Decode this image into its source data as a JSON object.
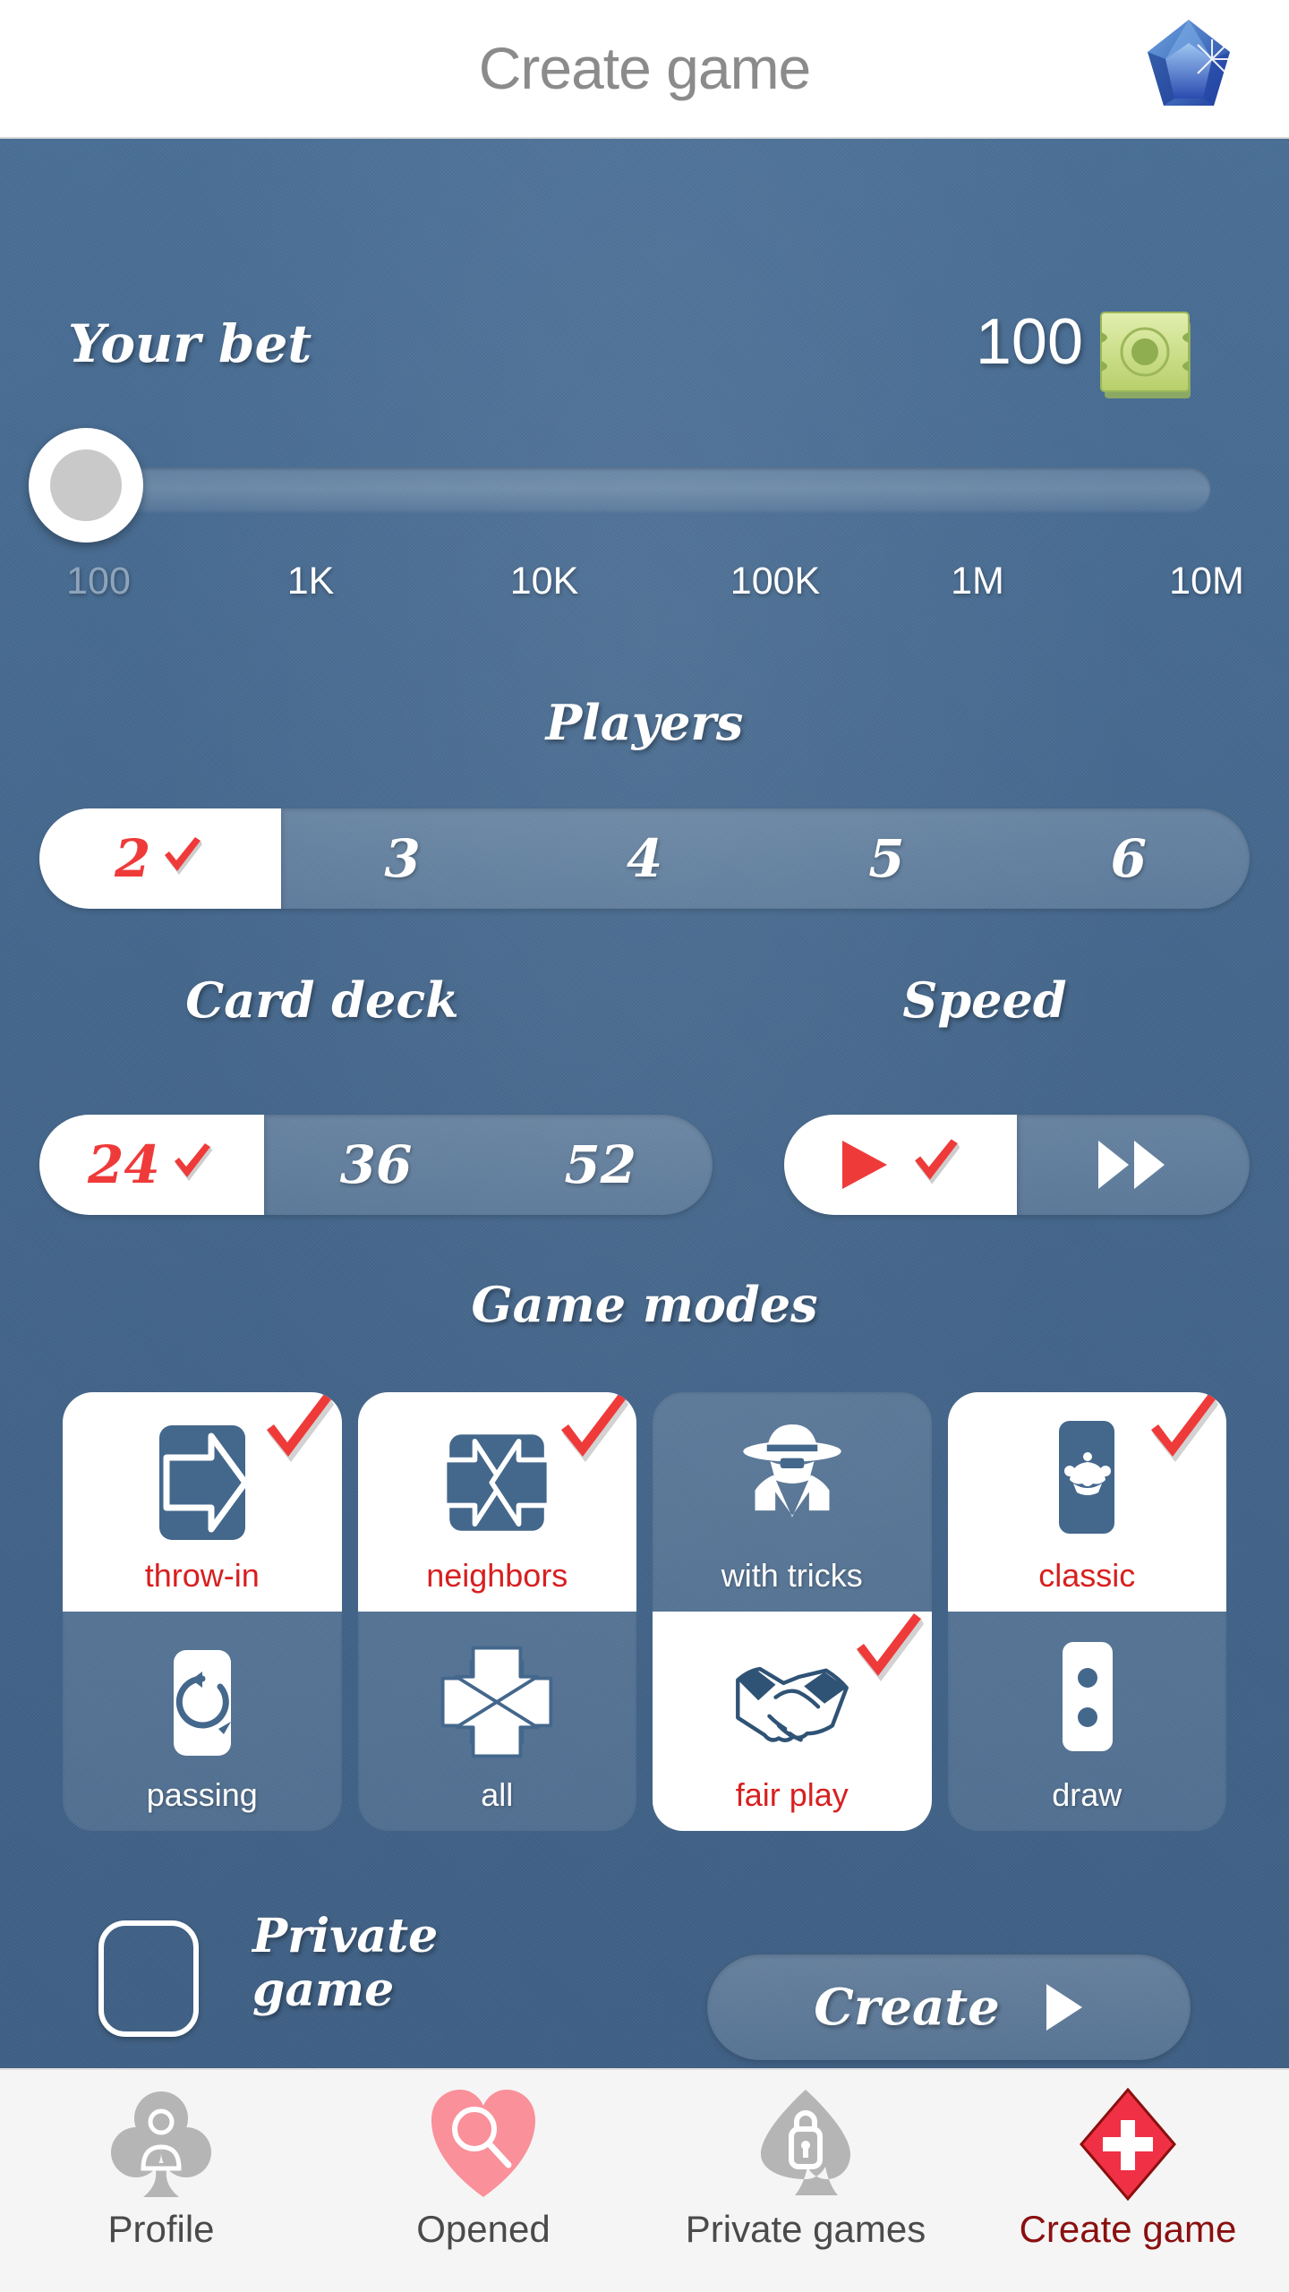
{
  "header": {
    "title": "Create game",
    "logo_icon": "blue-gem-icon"
  },
  "bet": {
    "label": "Your bet",
    "value": "100",
    "money_icon": "cash-banknote-icon",
    "slider": {
      "position_percent": 0,
      "current_tick": "100",
      "ticks": [
        "100",
        "1K",
        "10K",
        "100K",
        "1M",
        "10M"
      ]
    }
  },
  "players": {
    "title": "Players",
    "options": [
      "2",
      "3",
      "4",
      "5",
      "6"
    ],
    "selected": "2"
  },
  "card_deck": {
    "title": "Card deck",
    "options": [
      "24",
      "36",
      "52"
    ],
    "selected": "24"
  },
  "speed": {
    "title": "Speed",
    "options": [
      "normal-speed-icon",
      "fast-forward-icon"
    ],
    "selected": "normal-speed-icon"
  },
  "game_modes": {
    "title": "Game modes",
    "columns": [
      {
        "top": {
          "label": "throw-in",
          "icon": "arrow-right-throw-in-icon",
          "selected": true
        },
        "bottom": {
          "label": "passing",
          "icon": "circular-arrow-passing-icon",
          "selected": false
        }
      },
      {
        "top": {
          "label": "neighbors",
          "icon": "two-arrows-inward-icon",
          "selected": true
        },
        "bottom": {
          "label": "all",
          "icon": "four-arrows-inward-icon",
          "selected": false
        }
      },
      {
        "top": {
          "label": "with tricks",
          "icon": "cowboy-cheater-icon",
          "selected": false
        },
        "bottom": {
          "label": "fair play",
          "icon": "handshake-icon",
          "selected": true
        }
      },
      {
        "top": {
          "label": "classic",
          "icon": "joker-card-icon",
          "selected": true
        },
        "bottom": {
          "label": "draw",
          "icon": "two-dots-card-icon",
          "selected": false
        }
      }
    ]
  },
  "private_game": {
    "label": "Private\ngame",
    "label_line1": "Private",
    "label_line2": "game",
    "checked": false
  },
  "create_button": {
    "label": "Create",
    "arrow_icon": "play-arrow-icon"
  },
  "bottom_nav": {
    "items": [
      {
        "label": "Profile",
        "icon": "club-person-icon",
        "active": false
      },
      {
        "label": "Opened",
        "icon": "heart-search-icon",
        "active": false
      },
      {
        "label": "Private games",
        "icon": "spade-lock-icon",
        "active": false
      },
      {
        "label": "Create game",
        "icon": "diamond-plus-icon",
        "active": true
      }
    ]
  },
  "colors": {
    "background_blue": "#44678c",
    "accent_red": "#ef3a3a",
    "selected_label_red": "#d81f1f",
    "nav_active_red": "#8b0f0f",
    "nav_background": "#f5f5f5",
    "money_green": "#cfe08b",
    "heart_pink": "#f9909a",
    "grey_icon": "#b5b5b5"
  }
}
